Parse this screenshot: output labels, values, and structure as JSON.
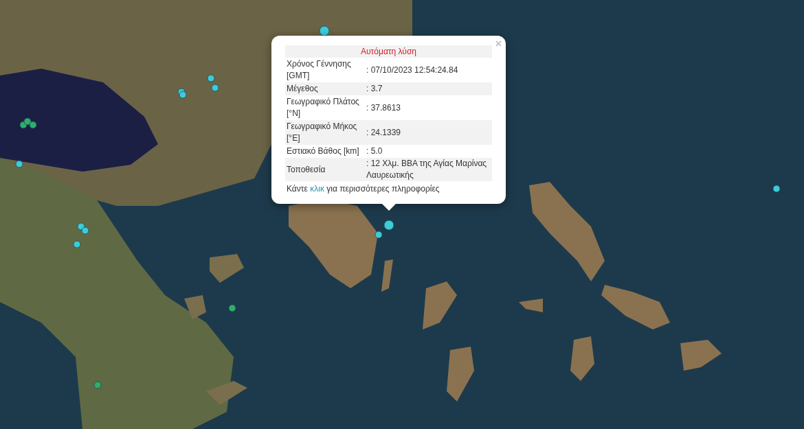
{
  "popup": {
    "close": "×",
    "title": "Αυτόματη λύση",
    "rows": [
      {
        "label": "Χρόνος Γέννησης [GMT]",
        "value": ": 07/10/2023 12:54:24.84"
      },
      {
        "label": "Μέγεθος",
        "value": ": 3.7"
      },
      {
        "label": "Γεωγραφικό Πλάτος [°N]",
        "value": ": 37.8613"
      },
      {
        "label": "Γεωγραφικό Μήκος [°E]",
        "value": ": 24.1339"
      },
      {
        "label": "Εστιακό Βάθος [km]",
        "value": ": 5.0"
      },
      {
        "label": "Τοποθεσία",
        "value": ": 12 Χλμ. ΒΒΑ της Αγίας Μαρίνας Λαυρεωτικής"
      }
    ],
    "footer": {
      "before": "Κάντε",
      "link": "κλικ",
      "after": "για περισσότερες πληροφορίες"
    }
  }
}
